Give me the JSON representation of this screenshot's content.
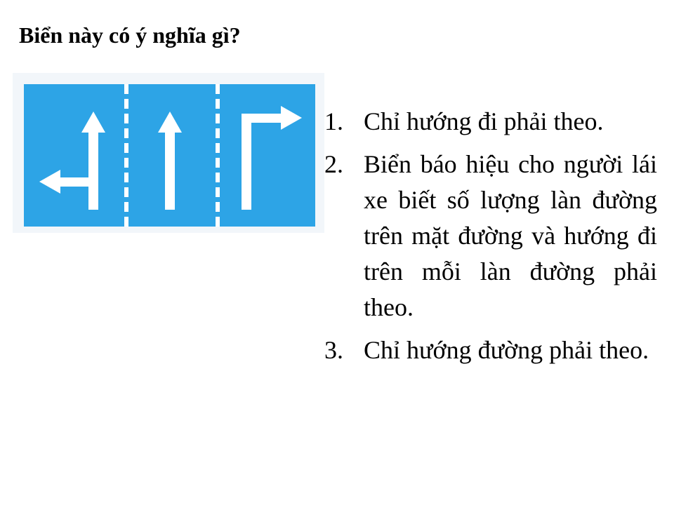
{
  "question": "Biển này có ý nghĩa gì?",
  "sign": {
    "icon": "lane-direction-sign-icon",
    "background_color": "#2da4e6",
    "marking_color": "#ffffff",
    "lanes": [
      "straight-or-left",
      "straight",
      "right"
    ]
  },
  "answers": [
    {
      "number": "1.",
      "text": "Chỉ hướng đi phải theo."
    },
    {
      "number": "2.",
      "text": "Biển báo hiệu cho người lái xe biết số lượng làn đường trên mặt đường và hướng đi trên mỗi làn đường phải theo."
    },
    {
      "number": "3.",
      "text": "Chỉ hướng đường phải theo."
    }
  ]
}
